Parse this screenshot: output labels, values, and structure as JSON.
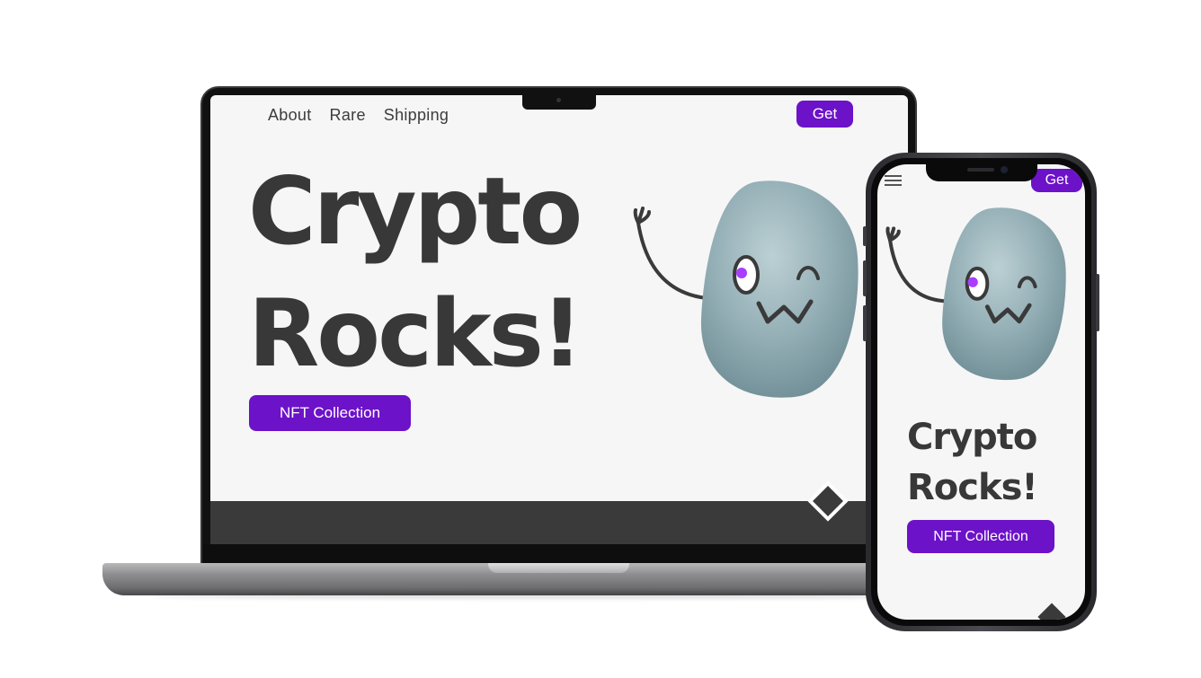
{
  "laptop_site": {
    "nav": [
      "About",
      "Rare",
      "Shipping"
    ],
    "get_button": "Get",
    "hero_line1": "Crypto",
    "hero_line2": "Rocks!",
    "cta_button": "NFT Collection"
  },
  "phone_site": {
    "get_button": "Get",
    "hero_line1": "Crypto",
    "hero_line2": "Rocks!",
    "cta_button": "NFT Collection"
  },
  "colors": {
    "accent": "#6c12c8",
    "text_dark": "#383838",
    "page_bg": "#f6f6f6",
    "footer_band": "#3a3a3a",
    "rock_eye_pupil": "#a93dff"
  },
  "icons": [
    "hamburger-menu-icon",
    "diamond-icon",
    "rock-mascot"
  ]
}
